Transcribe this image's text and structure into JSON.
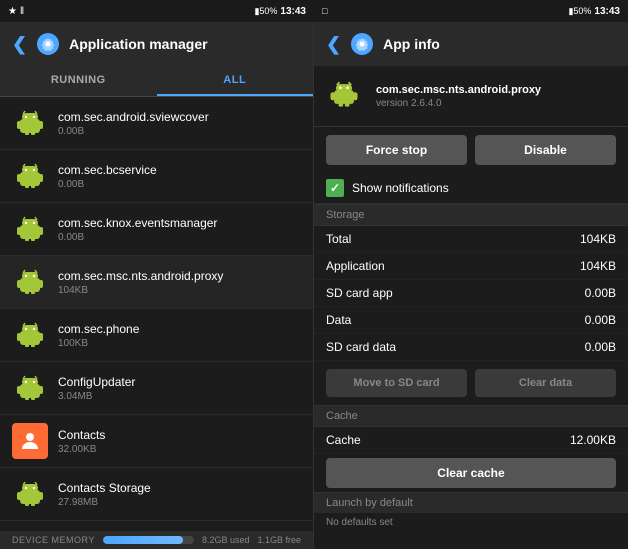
{
  "statusBar": {
    "time": "13:43",
    "battery": "50%"
  },
  "leftPanel": {
    "title": "Application manager",
    "tabs": [
      {
        "label": "RUNNING",
        "active": false
      },
      {
        "label": "ALL",
        "active": true
      }
    ],
    "apps": [
      {
        "name": "com.sec.android.sviewcover",
        "size": "0.00B",
        "type": "android"
      },
      {
        "name": "com.sec.bcservice",
        "size": "0.00B",
        "type": "android"
      },
      {
        "name": "com.sec.knox.eventsmanager",
        "size": "0.00B",
        "type": "android"
      },
      {
        "name": "com.sec.msc.nts.android.proxy",
        "size": "104KB",
        "type": "android"
      },
      {
        "name": "com.sec.phone",
        "size": "100KB",
        "type": "android"
      },
      {
        "name": "ConfigUpdater",
        "size": "3.04MB",
        "type": "android"
      },
      {
        "name": "Contacts",
        "size": "32.00KB",
        "type": "contacts"
      },
      {
        "name": "Contacts Storage",
        "size": "27.98MB",
        "type": "android"
      }
    ],
    "memoryBar": {
      "label": "Device memory",
      "used": "8.2GB used",
      "free": "1.1GB free",
      "fillPercent": 88
    }
  },
  "rightPanel": {
    "title": "App info",
    "app": {
      "package": "com.sec.msc.nts.android.proxy",
      "version": "version 2.6.4.0"
    },
    "buttons": {
      "forceStop": "Force stop",
      "disable": "Disable"
    },
    "showNotifications": "Show notifications",
    "storage": {
      "sectionLabel": "Storage",
      "rows": [
        {
          "label": "Total",
          "value": "104KB"
        },
        {
          "label": "Application",
          "value": "104KB"
        },
        {
          "label": "SD card app",
          "value": "0.00B"
        },
        {
          "label": "Data",
          "value": "0.00B"
        },
        {
          "label": "SD card data",
          "value": "0.00B"
        }
      ],
      "moveToSD": "Move to SD card",
      "clearData": "Clear data"
    },
    "cache": {
      "sectionLabel": "Cache",
      "rows": [
        {
          "label": "Cache",
          "value": "12.00KB"
        }
      ],
      "clearCache": "Clear cache"
    },
    "launch": {
      "sectionLabel": "Launch by default",
      "noDefaults": "No defaults set"
    }
  }
}
